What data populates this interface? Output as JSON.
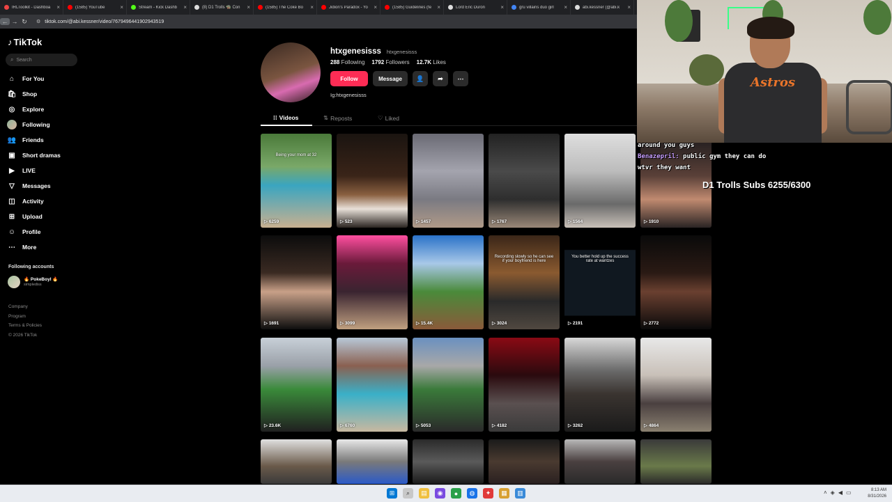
{
  "browser": {
    "tabs": [
      {
        "label": "IRLToolkit - Dashboa",
        "color": "#e44"
      },
      {
        "label": "(1585) YouTube",
        "color": "#f00"
      },
      {
        "label": "Stream - Kick Dashb",
        "color": "#53fc18"
      },
      {
        "label": "(8) D1 Trolls 🧌 Con",
        "color": "#ddd"
      },
      {
        "label": "(1585) The Coke Bo",
        "color": "#f00"
      },
      {
        "label": "Jidion's Paradox - Yo",
        "color": "#f00"
      },
      {
        "label": "(1585) Guidelines (fe",
        "color": "#f00"
      },
      {
        "label": "Lord Eric Duron",
        "color": "#ddd"
      },
      {
        "label": "gru villains duo girl",
        "color": "#4285f4"
      },
      {
        "label": "abi.kessner (@abi.k",
        "color": "#ddd"
      }
    ],
    "address": "tiktok.com/@abi.kessner/video/7679496441902943519"
  },
  "sidebar": {
    "logo": "TikTok",
    "search_placeholder": "Search",
    "items": [
      {
        "label": "For You",
        "icon": "home-icon",
        "glyph": "⌂"
      },
      {
        "label": "Shop",
        "icon": "shop-icon",
        "glyph": "🛍"
      },
      {
        "label": "Explore",
        "icon": "compass-icon",
        "glyph": "◎"
      },
      {
        "label": "Following",
        "icon": "following-avatar",
        "glyph": ""
      },
      {
        "label": "Friends",
        "icon": "friends-icon",
        "glyph": "👥"
      },
      {
        "label": "Short dramas",
        "icon": "dramas-icon",
        "glyph": "▣"
      },
      {
        "label": "LIVE",
        "icon": "live-icon",
        "glyph": "▶"
      },
      {
        "label": "Messages",
        "icon": "messages-icon",
        "glyph": "▽"
      },
      {
        "label": "Activity",
        "icon": "activity-icon",
        "glyph": "◫"
      },
      {
        "label": "Upload",
        "icon": "upload-icon",
        "glyph": "⊞"
      },
      {
        "label": "Profile",
        "icon": "profile-icon",
        "glyph": "☺"
      },
      {
        "label": "More",
        "icon": "more-icon",
        "glyph": "⋯"
      }
    ],
    "following_accounts_title": "Following accounts",
    "account": {
      "name": "🔥 PokeBoyl 🔥",
      "handle": "simplediss"
    },
    "footer": [
      "Company",
      "Program",
      "Terms & Policies",
      "© 2026 TikTok"
    ]
  },
  "profile": {
    "username": "htxgenesisss",
    "nickname": "htxgenesisss",
    "following_count": "288",
    "following_label": "Following",
    "followers_count": "1792",
    "followers_label": "Followers",
    "likes_count": "12.7K",
    "likes_label": "Likes",
    "follow_label": "Follow",
    "message_label": "Message",
    "bio": "Ig:htxgenesisss",
    "tabs": [
      "Videos",
      "Reposts",
      "Liked"
    ]
  },
  "videos": [
    {
      "views": "6259",
      "caption": "Being your mom at 32",
      "bg": "linear-gradient(180deg,#4a7a3a 0%,#7aa868 35%,#3aa5c0 55%,#c8b090 100%)"
    },
    {
      "views": "523",
      "caption": "",
      "bg": "linear-gradient(180deg,#1a1410 0%,#3a2418 45%,#8a6040 65%,#e8e0d8 80%,#2a2420 100%)"
    },
    {
      "views": "1457",
      "caption": "",
      "bg": "linear-gradient(180deg,#6a6a74 0%,#a4a4ae 40%,#7a7a82 70%,#b09a88 100%)"
    },
    {
      "views": "1767",
      "caption": "",
      "bg": "linear-gradient(180deg,#222 0%,#4a4a4a 40%,#2e2e2e 70%,#9a8878 100%)"
    },
    {
      "views": "1564",
      "caption": "",
      "bg": "linear-gradient(180deg,#dedede 0%,#bcbcbc 40%,#6a6a6a 75%,#c8c0b8 100%)"
    },
    {
      "views": "1910",
      "caption": "",
      "bg": "linear-gradient(180deg,#1c1a1c 0%,#5a4038 45%,#c08a70 70%,#2a2424 100%)"
    },
    {
      "views": "1691",
      "caption": "",
      "bg": "linear-gradient(180deg,#0c0c0c 0%,#3a2a22 40%,#c8a088 60%,#0e0e0e 100%)"
    },
    {
      "views": "3099",
      "caption": "",
      "bg": "linear-gradient(180deg,#ff4fa0 0%,#6a1a3a 30%,#3a2430 60%,#c0a080 100%)"
    },
    {
      "views": "15.4K",
      "caption": "",
      "bg": "linear-gradient(180deg,#2a72c8 0%,#a8c8e8 30%,#4a8a3a 60%,#8a5a3a 100%)"
    },
    {
      "views": "3024",
      "caption": "Recording slowly so he can see if your boyfriend is here",
      "bg": "linear-gradient(180deg,#3a2618 0%,#8a5a30 40%,#2a2a2a 70%,#504840 100%)"
    },
    {
      "views": "2191",
      "caption": "You better hold up the success rate at wantzes",
      "bg": "linear-gradient(180deg,#000 0%,#000 15%,#101820 16%,#101820 85%,#000 86%,#000 100%)"
    },
    {
      "views": "2772",
      "caption": "",
      "bg": "linear-gradient(180deg,#0a0a0a 0%,#2a1a14 40%,#6a4030 60%,#0a0a0a 100%)"
    },
    {
      "views": "23.6K",
      "caption": "",
      "bg": "linear-gradient(180deg,#c8d0d8 0%,#9aa0a8 30%,#3a8a3a 55%,#202020 100%)"
    },
    {
      "views": "6760",
      "caption": "",
      "bg": "linear-gradient(180deg,#b8c8d8 0%,#8a6050 30%,#3ab0c8 60%,#c8b8a0 100%)"
    },
    {
      "views": "5053",
      "caption": "",
      "bg": "linear-gradient(180deg,#6a90c0 0%,#a8a8a8 30%,#3a7a3a 55%,#2a2a2a 100%)"
    },
    {
      "views": "4182",
      "caption": "",
      "bg": "linear-gradient(180deg,#8a0a14 0%,#2a0a0e 40%,#5a5050 70%,#3a3a3a 100%)"
    },
    {
      "views": "3262",
      "caption": "",
      "bg": "linear-gradient(180deg,#d8d8d8 0%,#6a6a6a 35%,#3a3430 60%,#1a1a1a 100%)"
    },
    {
      "views": "4864",
      "caption": "",
      "bg": "linear-gradient(180deg,#e8e8e8 0%,#c8c0b8 40%,#4a4040 70%,#8a8070 100%)"
    },
    {
      "views": "",
      "caption": "",
      "bg": "linear-gradient(180deg,#e0e0e0 0%,#6a5a4a 60%,#3a3a3a 100%)"
    },
    {
      "views": "",
      "caption": "",
      "bg": "linear-gradient(180deg,#e8e8e8 0%,#7a7a7a 50%,#2a5ac8 100%)"
    },
    {
      "views": "",
      "caption": "",
      "bg": "linear-gradient(180deg,#2a2a2a 0%,#5a5a5a 50%,#1a1a1a 100%)"
    },
    {
      "views": "",
      "caption": "",
      "bg": "linear-gradient(180deg,#1a1a1a 0%,#4a3a30 50%,#2a2020 100%)"
    },
    {
      "views": "",
      "caption": "",
      "bg": "linear-gradient(180deg,#b8b8b8 0%,#4a4040 50%,#2a2a2a 100%)"
    },
    {
      "views": "",
      "caption": "",
      "bg": "linear-gradient(180deg,#3a3a3a 0%,#6a7a4a 60%,#2a2a2a 100%)"
    }
  ],
  "stream_overlay": {
    "chat_lines": [
      {
        "user": "",
        "text": "around you guys"
      },
      {
        "user": "Benazepril:",
        "text": " public gym they can do"
      },
      {
        "user": "",
        "text": "wtvr they want"
      }
    ],
    "sub_goal": "D1 Trolls Subs 6255/6300",
    "jersey_text": "Astros"
  },
  "taskbar": {
    "time": "8:13 AM",
    "date": "8/31/2026"
  }
}
